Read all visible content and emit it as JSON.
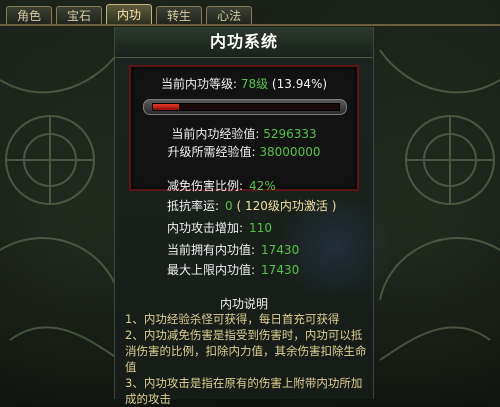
{
  "tabs": [
    "角色",
    "宝石",
    "内功",
    "转生",
    "心法"
  ],
  "active_tab_index": 2,
  "panel_title": "内功系统",
  "level": {
    "label": "当前内功等级:",
    "value": "78级",
    "percent_text": "(13.94%)",
    "progress_fraction": 0.1394
  },
  "exp": {
    "current_label": "当前内功经验值:",
    "current_value": "5296333",
    "needed_label": "升级所需经验值:",
    "needed_value": "38000000"
  },
  "stats": [
    {
      "label": "减免伤害比例:",
      "value": "42%",
      "extra": ""
    },
    {
      "label": "抵抗率运:",
      "value": "0",
      "extra": "( 120级内功激活 )"
    },
    {
      "label": "内功攻击增加:",
      "value": "110",
      "extra": ""
    },
    {
      "label": "当前拥有内功值:",
      "value": "17430",
      "extra": ""
    },
    {
      "label": "最大上限内功值:",
      "value": "17430",
      "extra": ""
    }
  ],
  "description": {
    "title": "内功说明",
    "lines": [
      "1、内功经验杀怪可获得，每日首充可获得",
      "2、内功减免伤害是指受到伤害时，内功可以抵消伤害的比例，扣除内力值，其余伤害扣除生命值",
      "3、内功攻击是指在原有的伤害上附带内功所加成的攻击"
    ]
  },
  "colors": {
    "accent_green": "#52c444",
    "progress_red": "#e23b2a",
    "box_border": "#5a1414",
    "description_text": "#e0d090"
  }
}
